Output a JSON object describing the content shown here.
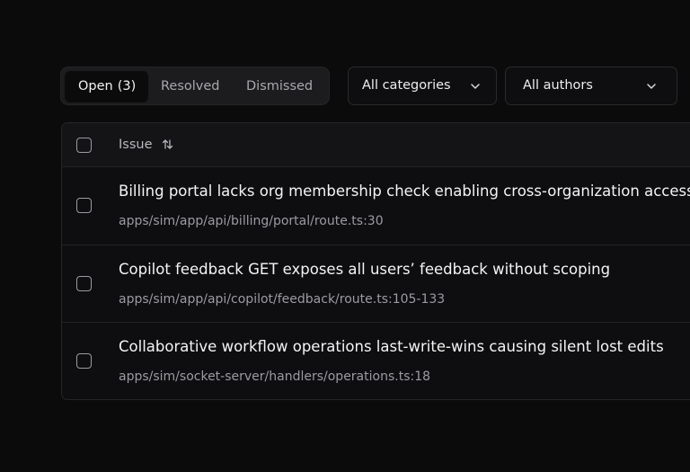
{
  "filters": {
    "tabs": [
      {
        "label": "Open",
        "count": "(3)",
        "active": true
      },
      {
        "label": "Resolved"
      },
      {
        "label": "Dismissed"
      }
    ],
    "category_select": "All categories",
    "author_select": "All authors"
  },
  "table": {
    "header": {
      "issue_label": "Issue",
      "sort_icon": "sort-arrows-icon"
    },
    "rows": [
      {
        "title": "Billing portal lacks org membership check enabling cross-organization access",
        "path": "apps/sim/app/api/billing/portal/route.ts:30"
      },
      {
        "title": "Copilot feedback GET exposes all users’ feedback without scoping",
        "path": "apps/sim/app/api/copilot/feedback/route.ts:105-133"
      },
      {
        "title": "Collaborative workflow operations last-write-wins causing silent lost edits",
        "path": "apps/sim/socket-server/handlers/operations.ts:18"
      }
    ]
  },
  "colors": {
    "background": "#0b0b0c",
    "surface": "#1c1c1e",
    "text_primary": "#f4f4f4",
    "text_secondary": "#9b9ba1"
  }
}
